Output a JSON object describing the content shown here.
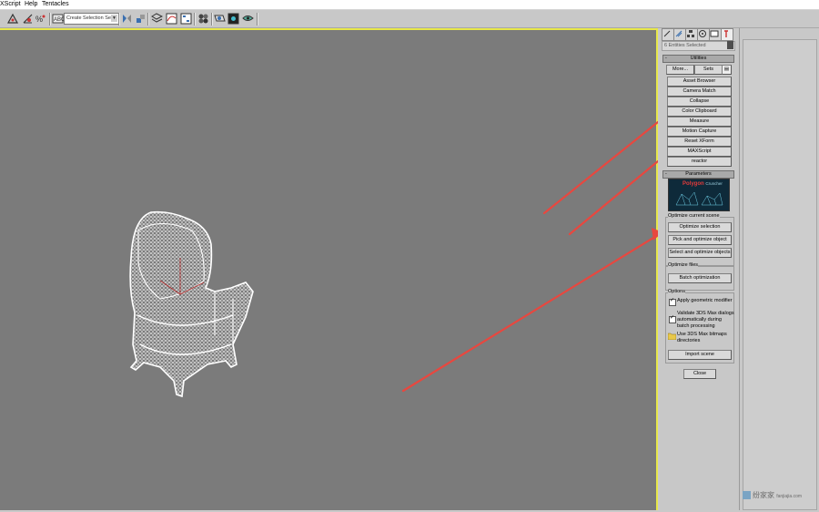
{
  "menu": [
    "XScript",
    "Help",
    "Tentacles"
  ],
  "toolbar": {
    "selection_set_placeholder": "Create Selection Set"
  },
  "panel": {
    "entities_selected": "6 Entities Selected",
    "utilities": {
      "title": "Utilities",
      "more_label": "More...",
      "sets_label": "Sets",
      "buttons": [
        "Asset Browser",
        "Camera Match",
        "Collapse",
        "Color Clipboard",
        "Measure",
        "Motion Capture",
        "Reset XForm",
        "MAXScript",
        "reactor"
      ]
    },
    "parameters": {
      "title": "Parameters",
      "logo_text": "Polygon",
      "logo_sub": "Cruncher",
      "optimize_scene_label": "Optimize current scene",
      "optimize_selection": "Optimize selection",
      "pick_optimize": "Pick and optimize object",
      "select_optimize": "Select and optimize objects",
      "optimize_files_label": "Optimize files",
      "batch_optimization": "Batch optimization",
      "options_label": "Options",
      "apply_modifier": "Apply geometric modifier",
      "validate_line1": "Validate 3DS Max dialogs",
      "validate_line2": "automatically during",
      "validate_line3": "batch processing",
      "bitmaps_line1": "Use 3DS Max bitmaps",
      "bitmaps_line2": "directories",
      "import_scene": "Import scene",
      "close": "Close"
    }
  },
  "watermark": {
    "text": "纷家家",
    "sub": "fanjiajia.com"
  },
  "colors": {
    "viewport_bg": "#7b7b7b",
    "viewport_border": "#e8e84a",
    "arrow": "#e8473f",
    "panel_bg": "#c8c8c8",
    "mesh": "#ffffff"
  }
}
